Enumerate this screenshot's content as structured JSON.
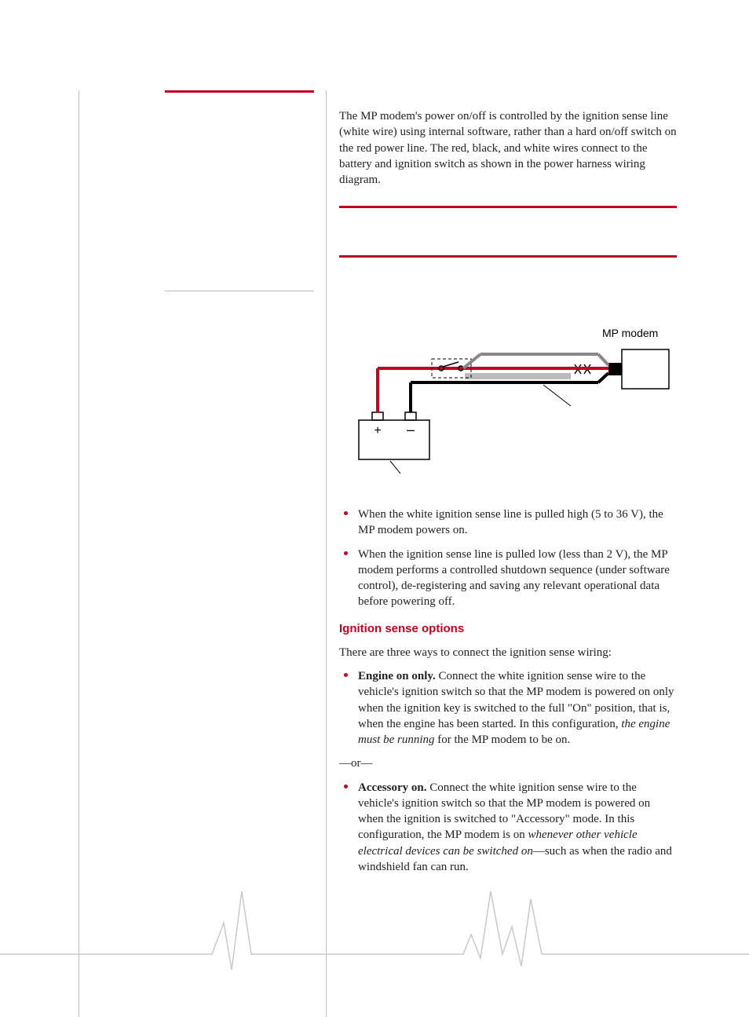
{
  "intro_para": "The MP modem's power on/off is controlled by the ignition sense line (white wire) using internal software, rather than a hard on/off switch on the red power line. The red, black, and white wires connect to the battery and ignition switch as shown in the power harness wiring diagram.",
  "diagram": {
    "label_mp_modem": "MP modem"
  },
  "sense_bullets": [
    "When the white ignition sense line is pulled high (5 to 36 V), the MP modem powers on.",
    "When the ignition sense line is pulled low (less than 2 V), the MP modem performs a controlled shutdown sequence (under software control), de-registering and saving any relevant operational data before powering off."
  ],
  "heading_ignition": "Ignition sense options",
  "intro_three_ways": "There are three ways to connect the ignition sense wiring:",
  "option_engine": {
    "label": "Engine on only.",
    "text_before_italic": " Connect the white ignition sense wire to the vehicle's ignition switch so that the MP modem is powered on only when the ignition key is switched to the full \"On\" position, that is, when the engine has been started. In this configuration, ",
    "italic": "the engine must be running",
    "text_after_italic": " for the MP modem to be on."
  },
  "or_text": "—or—",
  "option_accessory": {
    "label": "Accessory on.",
    "text_before_italic": " Connect the white ignition sense wire to the vehicle's ignition switch so that the MP modem is powered on when the ignition is switched to \"Accessory\" mode. In this configuration, the MP modem is on ",
    "italic": "whenever other vehicle electrical devices can be switched on",
    "text_after_italic": "—such as when the radio and windshield fan can run."
  }
}
